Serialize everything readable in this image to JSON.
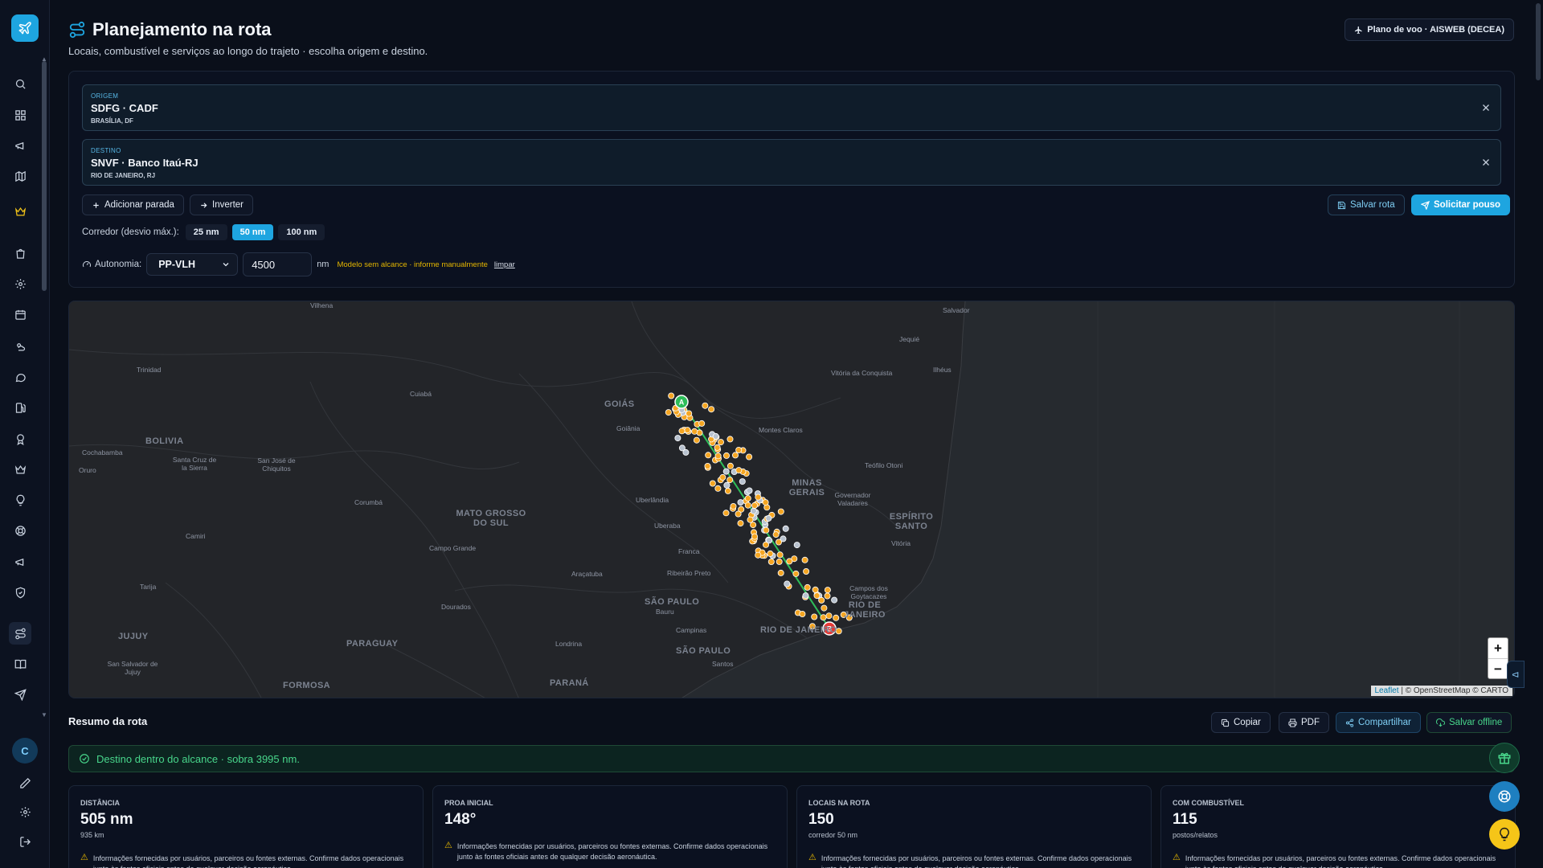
{
  "header": {
    "title": "Planejamento na rota",
    "subtitle": "Locais, combustível e serviços ao longo do trajeto · escolha origem e destino.",
    "flight_plan_button": "Plano de voo · AISWEB (DECEA)"
  },
  "sidebar": {
    "avatar_initial": "C",
    "items": [
      "search-icon",
      "dashboard-icon",
      "megaphone-icon",
      "map-icon",
      "crown-icon",
      "bag-icon",
      "gear-icon",
      "calendar-icon",
      "weather-icon",
      "chat-icon",
      "fuel-icon",
      "award-icon",
      "crown-icon",
      "lightbulb-icon",
      "lifebuoy-icon",
      "megaphone-icon",
      "shield-icon",
      "route-icon",
      "book-icon",
      "send-icon"
    ]
  },
  "route": {
    "origin": {
      "label": "ORIGEM",
      "value": "SDFG · CADF",
      "sub": "BRASÍLIA, DF"
    },
    "destination": {
      "label": "DESTINO",
      "value": "SNVF · Banco Itaú-RJ",
      "sub": "RIO DE JANEIRO, RJ"
    },
    "add_stop": "Adicionar parada",
    "invert": "Inverter",
    "save_route": "Salvar rota",
    "request_landing": "Solicitar pouso",
    "corridor_label": "Corredor (desvio máx.):",
    "corridor_options": [
      "25 nm",
      "50 nm",
      "100 nm"
    ],
    "corridor_selected": "50 nm",
    "autonomy_label": "Autonomia:",
    "aircraft": "PP-VLH",
    "range_value": "4500",
    "range_unit": "nm",
    "model_warning": "Modelo sem alcance · informe manualmente",
    "clear": "limpar"
  },
  "map": {
    "labels": {
      "vilhena": "Vilhena",
      "salvador": "Salvador",
      "jequie": "Jequié",
      "trinidad": "Trinidad",
      "vitoria_conquista": "Vitória da Conquista",
      "ilheus": "Ilhéus",
      "cuiaba": "Cuiabá",
      "goias": "GOIÁS",
      "bolivia": "BOLIVIA",
      "goiania": "Goiânia",
      "montes_claros": "Montes Claros",
      "cochabamba": "Cochabamba",
      "santa_cruz": "Santa Cruz de la Sierra",
      "san_jose": "San José de Chiquitos",
      "teofilo": "Teófilo Otoni",
      "oruro": "Oruro",
      "minas": "MINAS GERAIS",
      "gov_valadares": "Governador Valadares",
      "uberlandia": "Uberlândia",
      "corumba": "Corumbá",
      "mato_grosso": "MATO GROSSO DO SUL",
      "espirito": "ESPÍRITO SANTO",
      "uberaba": "Uberaba",
      "camiri": "Camiri",
      "vitoria": "Vitória",
      "franca": "Franca",
      "campo_grande": "Campo Grande",
      "tarija": "Tarija",
      "aracatuba": "Araçatuba",
      "ribeirao": "Ribeirão Preto",
      "campos": "Campos dos Goytacazes",
      "sao_paulo_state": "SÃO PAULO",
      "rio_state": "RIO DE JANEIRO",
      "dourados": "Dourados",
      "bauru": "Bauru",
      "campinas": "Campinas",
      "rio_city": "RIO DE JANEIRO",
      "jujuy": "JUJUY",
      "paraguay": "PARAGUAY",
      "londrina": "Londrina",
      "sao_paulo_city": "SÃO PAULO",
      "san_salvador": "San Salvador de Jujuy",
      "santos": "Santos",
      "formosa": "FORMOSA",
      "parana": "PARANÁ"
    },
    "marker_a": "A",
    "marker_b": "B",
    "zoom_in": "+",
    "zoom_out": "−",
    "attribution_leaflet": "Leaflet",
    "attribution_rest": "| © OpenStreetMap © CARTO"
  },
  "summary": {
    "title": "Resumo da rota",
    "copy": "Copiar",
    "pdf": "PDF",
    "share": "Compartilhar",
    "save_offline": "Salvar offline",
    "alert": "Destino dentro do alcance · sobra 3995 nm.",
    "disclaimer": "Informações fornecidas por usuários, parceiros ou fontes externas. Confirme dados operacionais junto às fontes oficiais antes de qualquer decisão aeronáutica.",
    "cards": [
      {
        "label": "DISTÂNCIA",
        "value": "505 nm",
        "sub": "935 km"
      },
      {
        "label": "PROA INICIAL",
        "value": "148°",
        "sub": ""
      },
      {
        "label": "LOCAIS NA ROTA",
        "value": "150",
        "sub": "corredor 50 nm"
      },
      {
        "label": "COM COMBUSTÍVEL",
        "value": "115",
        "sub": "postos/relatos"
      }
    ]
  },
  "colors": {
    "accent": "#1ea5e0",
    "success": "#48d68b",
    "warning": "#e5b700",
    "route_line": "#2ebd59",
    "poi_fuel": "#f5a623",
    "poi_other": "#b8c2cf",
    "marker_b": "#e53935"
  }
}
